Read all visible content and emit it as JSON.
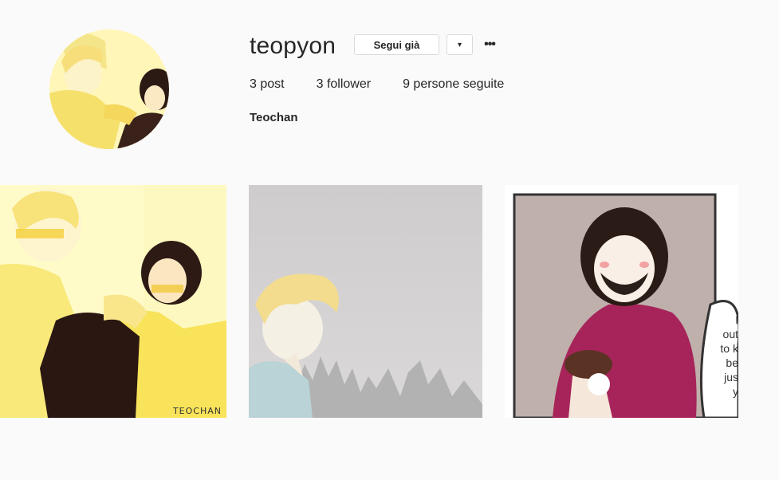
{
  "profile": {
    "username": "teopyon",
    "follow_button": "Segui già",
    "dropdown_icon": "▾",
    "more_icon": "•••",
    "full_name": "Teochan",
    "stats": {
      "posts": "3 post",
      "followers": "3 follower",
      "following": "9 persone seguite"
    }
  },
  "posts": [
    {
      "alt": "two boys in yellow sweaters",
      "watermark": "TEOCHAN"
    },
    {
      "alt": "blond boy in foggy forest"
    },
    {
      "alt": "dark-haired boy with ice cream",
      "speech_bubble": [
        "I",
        "out",
        "to k",
        "be",
        "jus",
        "y"
      ]
    }
  ],
  "colors": {
    "text": "#262626",
    "border": "#dbdbdb",
    "background": "#fafafa"
  }
}
